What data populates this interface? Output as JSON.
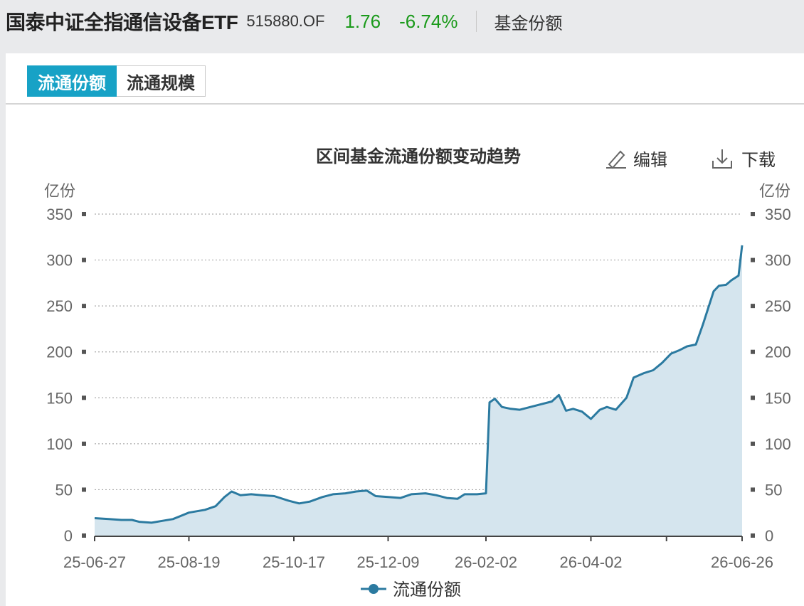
{
  "header": {
    "fund_name": "国泰中证全指通信设备ETF",
    "fund_code": "515880.OF",
    "price": "1.76",
    "change_pct": "-6.74%",
    "section": "基金份额",
    "change_color": "#1a9a1a"
  },
  "tabs": [
    {
      "label": "流通份额",
      "active": true
    },
    {
      "label": "流通规模",
      "active": false
    }
  ],
  "toolbar": {
    "edit_label": "编辑",
    "edit_icon": "pencil-icon",
    "download_label": "下载",
    "download_icon": "download-icon"
  },
  "colors": {
    "accent": "#17a2c6",
    "line": "#2b7aa0",
    "area": "#d5e5ee"
  },
  "chart_data": {
    "type": "area",
    "title": "区间基金流通份额变动趋势",
    "y_unit_left": "亿份",
    "y_unit_right": "亿份",
    "ylim": [
      0,
      350
    ],
    "yticks": [
      0,
      50,
      100,
      150,
      200,
      250,
      300,
      350
    ],
    "x_range": [
      "25-06-27",
      "26-06-26"
    ],
    "xticks": [
      "25-06-27",
      "25-08-19",
      "25-10-17",
      "25-12-09",
      "26-02-02",
      "26-04-02",
      "26-06-26"
    ],
    "grid": true,
    "legend_position": "bottom",
    "series": [
      {
        "name": "流通份额",
        "points": [
          [
            "25-06-27",
            19
          ],
          [
            "25-07-05",
            18
          ],
          [
            "25-07-12",
            17
          ],
          [
            "25-07-18",
            17
          ],
          [
            "25-07-22",
            15
          ],
          [
            "25-07-29",
            14
          ],
          [
            "25-08-04",
            16
          ],
          [
            "25-08-10",
            18
          ],
          [
            "25-08-19",
            25
          ],
          [
            "25-08-28",
            28
          ],
          [
            "25-09-03",
            32
          ],
          [
            "25-09-08",
            42
          ],
          [
            "25-09-12",
            48
          ],
          [
            "25-09-17",
            44
          ],
          [
            "25-09-23",
            45
          ],
          [
            "25-09-29",
            44
          ],
          [
            "25-10-06",
            43
          ],
          [
            "25-10-14",
            38
          ],
          [
            "25-10-20",
            35
          ],
          [
            "25-10-26",
            37
          ],
          [
            "25-11-02",
            42
          ],
          [
            "25-11-08",
            45
          ],
          [
            "25-11-15",
            46
          ],
          [
            "25-11-21",
            48
          ],
          [
            "25-11-27",
            49
          ],
          [
            "25-12-02",
            43
          ],
          [
            "25-12-09",
            42
          ],
          [
            "25-12-16",
            41
          ],
          [
            "25-12-22",
            45
          ],
          [
            "25-12-30",
            46
          ],
          [
            "26-01-05",
            44
          ],
          [
            "26-01-11",
            41
          ],
          [
            "26-01-17",
            40
          ],
          [
            "26-01-21",
            45
          ],
          [
            "26-01-28",
            45
          ],
          [
            "26-02-02",
            46
          ],
          [
            "26-02-04",
            145
          ],
          [
            "26-02-07",
            149
          ],
          [
            "26-02-11",
            140
          ],
          [
            "26-02-16",
            138
          ],
          [
            "26-02-21",
            137
          ],
          [
            "26-02-27",
            140
          ],
          [
            "26-03-05",
            143
          ],
          [
            "26-03-11",
            146
          ],
          [
            "26-03-15",
            153
          ],
          [
            "26-03-19",
            136
          ],
          [
            "26-03-23",
            138
          ],
          [
            "26-03-28",
            135
          ],
          [
            "26-04-02",
            127
          ],
          [
            "26-04-07",
            137
          ],
          [
            "26-04-11",
            140
          ],
          [
            "26-04-16",
            137
          ],
          [
            "26-04-22",
            150
          ],
          [
            "26-04-26",
            172
          ],
          [
            "26-05-02",
            177
          ],
          [
            "26-05-07",
            180
          ],
          [
            "26-05-12",
            188
          ],
          [
            "26-05-17",
            198
          ],
          [
            "26-05-22",
            202
          ],
          [
            "26-05-26",
            206
          ],
          [
            "26-05-31",
            208
          ],
          [
            "26-06-04",
            230
          ],
          [
            "26-06-10",
            266
          ],
          [
            "26-06-13",
            272
          ],
          [
            "26-06-17",
            273
          ],
          [
            "26-06-20",
            278
          ],
          [
            "26-06-24",
            283
          ],
          [
            "26-06-26",
            316
          ]
        ]
      }
    ]
  }
}
